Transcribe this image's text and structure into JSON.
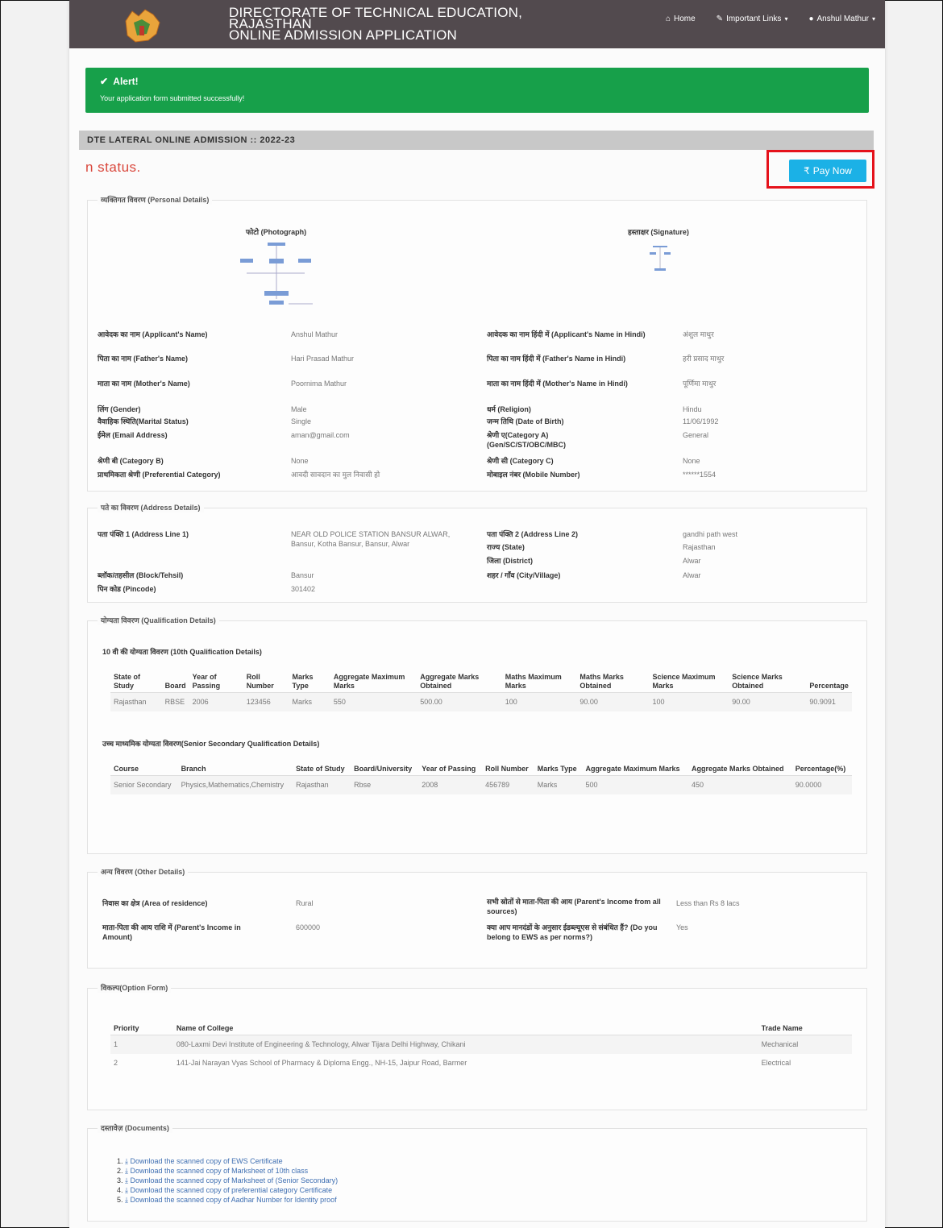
{
  "header": {
    "title_line1": "DIRECTORATE OF TECHNICAL EDUCATION,",
    "title_line2": "RAJASTHAN",
    "title_line3": "ONLINE ADMISSION APPLICATION",
    "nav": {
      "home": "Home",
      "links": "Important Links",
      "user": "Anshul Mathur"
    }
  },
  "alert": {
    "title": "Alert!",
    "message": "Your application form submitted successfully!"
  },
  "section_title": "DTE LATERAL ONLINE ADMISSION :: 2022-23",
  "status_text": "n status.",
  "pay_button": "Pay Now",
  "personal": {
    "legend": "व्यक्तिगत विवरण (Personal Details)",
    "photo_label": "फोटो (Photograph)",
    "signature_label": "हस्ताक्षर (Signature)",
    "fields": {
      "applicant_name_label": "आवेदक का नाम (Applicant's Name)",
      "applicant_name": "Anshul Mathur",
      "applicant_name_hindi_label": "आवेदक का नाम हिंदी में (Applicant's Name in Hindi)",
      "applicant_name_hindi": "अंशुल माथुर",
      "father_label": "पिता का नाम (Father's Name)",
      "father": "Hari Prasad Mathur",
      "father_hindi_label": "पिता का नाम हिंदी में (Father's Name in Hindi)",
      "father_hindi": "हरी प्रसाद माथुर",
      "mother_label": "माता का नाम (Mother's Name)",
      "mother": "Poornima Mathur",
      "mother_hindi_label": "माता का नाम हिंदी में (Mother's Name in Hindi)",
      "mother_hindi": "पूर्णिमा माथुर",
      "gender_label": "लिंग (Gender)",
      "gender": "Male",
      "religion_label": "धर्म (Religion)",
      "religion": "Hindu",
      "marital_label": "वैवाहिक स्थिति(Marital Status)",
      "marital": "Single",
      "dob_label": "जन्म तिथि (Date of Birth)",
      "dob": "11/06/1992",
      "email_label": "ईमेल (Email Address)",
      "email": "aman@gmail.com",
      "cat_a_label": "श्रेणी ए(Category A) (Gen/SC/ST/OBC/MBC)",
      "cat_a": "General",
      "cat_b_label": "श्रेणी बी (Category B)",
      "cat_b": "None",
      "cat_c_label": "श्रेणी सी (Category C)",
      "cat_c": "None",
      "pref_label": "प्राथमिकता श्रेणी (Preferential Category)",
      "pref": "आवदी सावदान का मुल निवासी हो",
      "mobile_label": "मोबाइल नंबर (Mobile Number)",
      "mobile": "******1554"
    }
  },
  "address": {
    "legend": "पते का विवरण (Address Details)",
    "line1_label": "पता पंक्ति 1 (Address Line 1)",
    "line1": "NEAR OLD POLICE STATION BANSUR ALWAR, Bansur, Kotha Bansur, Bansur, Alwar",
    "line2_label": "पता पंक्ति 2 (Address Line 2)",
    "line2": "gandhi path west",
    "state_label": "राज्य (State)",
    "state": "Rajasthan",
    "district_label": "जिला (District)",
    "district": "Alwar",
    "block_label": "ब्लॉक/तहसील (Block/Tehsil)",
    "block": "Bansur",
    "city_label": "शहर / गाँव (City/Village)",
    "city": "Alwar",
    "pin_label": "पिन कोड (Pincode)",
    "pin": "301402"
  },
  "qualification": {
    "legend": "योग्यता विवरण (Qualification Details)",
    "tenth_title": "10 वी की योग्यता विवरण (10th Qualification Details)",
    "tenth_headers": [
      "State of Study",
      "Board",
      "Year of Passing",
      "Roll Number",
      "Marks Type",
      "Aggregate Maximum Marks",
      "Aggregate Marks Obtained",
      "Maths Maximum Marks",
      "Maths Marks Obtained",
      "Science Maximum Marks",
      "Science Marks Obtained",
      "Percentage"
    ],
    "tenth_row": [
      "Rajasthan",
      "RBSE",
      "2006",
      "123456",
      "Marks",
      "550",
      "500.00",
      "100",
      "90.00",
      "100",
      "90.00",
      "90.9091"
    ],
    "senior_title": "उच्च माध्यमिक योग्यता विवरण(Senior Secondary Qualification Details)",
    "senior_headers": [
      "Course",
      "Branch",
      "State of Study",
      "Board/University",
      "Year of Passing",
      "Roll Number",
      "Marks Type",
      "Aggregate Maximum Marks",
      "Aggregate Marks Obtained",
      "Percentage(%)"
    ],
    "senior_row": [
      "Senior Secondary",
      "Physics,Mathematics,Chemistry",
      "Rajasthan",
      "Rbse",
      "2008",
      "456789",
      "Marks",
      "500",
      "450",
      "90.0000"
    ]
  },
  "other": {
    "legend": "अन्य विवरण (Other Details)",
    "area_label": "निवास का क्षेत्र (Area of residence)",
    "area": "Rural",
    "income_src_label": "सभी स्रोतों से माता-पिता की आय (Parent's Income from all sources)",
    "income_src": "Less than Rs 8 lacs",
    "income_amt_label": "माता-पिता की आय राशि में (Parent's Income in Amount)",
    "income_amt": "600000",
    "ews_label": "क्या आप मानदंडों के अनुसार ईडब्ल्यूएस से संबंधित हैं? (Do you belong to EWS as per norms?)",
    "ews": "Yes"
  },
  "options": {
    "legend": "विकल्प(Option Form)",
    "headers": [
      "Priority",
      "Name of College",
      "Trade Name"
    ],
    "rows": [
      [
        "1",
        "080-Laxmi Devi Institute of Engineering & Technology, Alwar Tijara Delhi Highway, Chikani",
        "Mechanical"
      ],
      [
        "2",
        "141-Jai Narayan Vyas School of Pharmacy & Diploma Engg., NH-15, Jaipur Road, Barmer",
        "Electrical"
      ]
    ]
  },
  "documents": {
    "legend": "दस्तावेज़ (Documents)",
    "items": [
      "Download the scanned copy of EWS Certificate",
      "Download the scanned copy of Marksheet of 10th class",
      "Download the scanned copy of Marksheet of (Senior Secondary)",
      "Download the scanned copy of preferential category Certificate",
      "Download the scanned copy of Aadhar Number for Identity proof"
    ]
  },
  "colors": {
    "header": "#524a4e",
    "alert": "#17a04a",
    "pay": "#1bb1e6",
    "highlight": "#e5121b",
    "status": "#d9463b"
  }
}
